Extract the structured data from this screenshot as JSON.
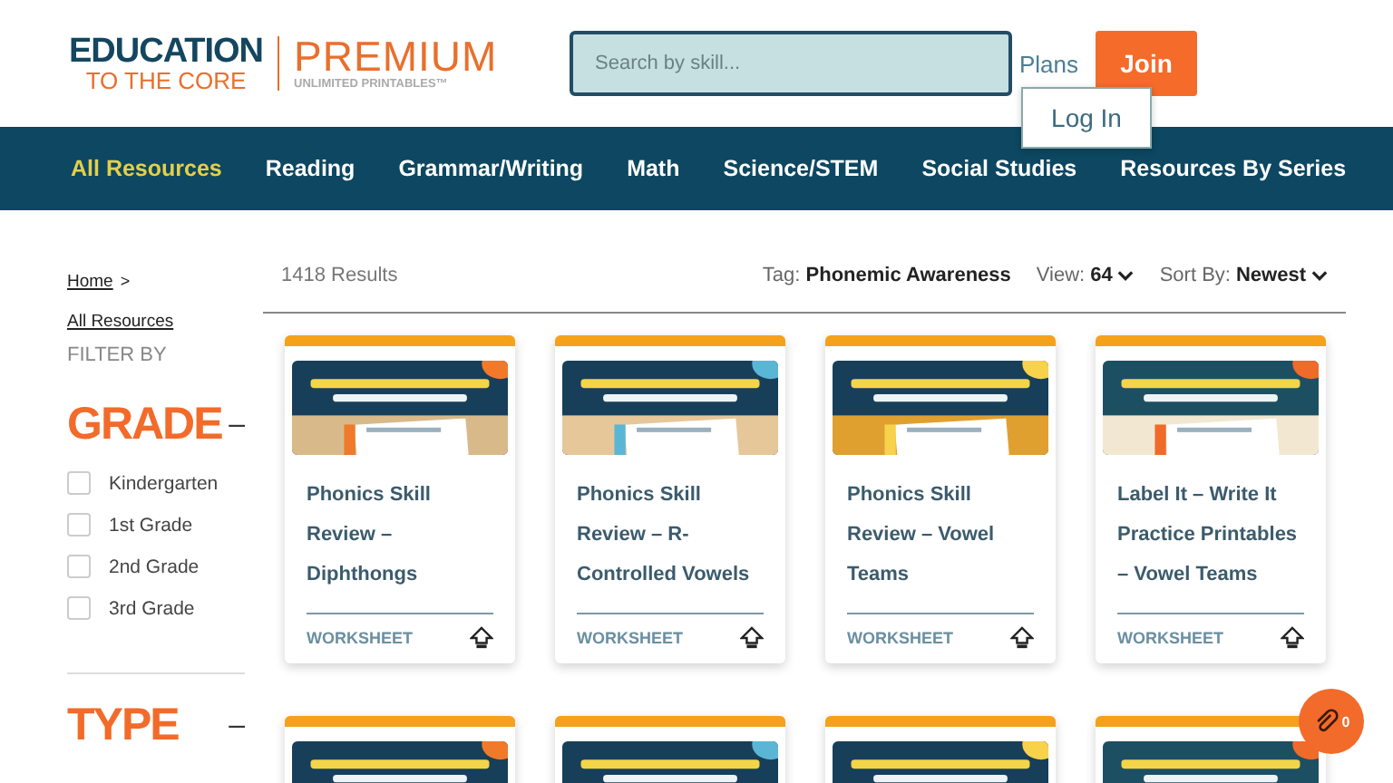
{
  "logo": {
    "line_1": "EDUCATION",
    "line_2": "TO THE CORE",
    "premium": "PREMIUM",
    "tagline": "UNLIMITED PRINTABLES™"
  },
  "search": {
    "placeholder": "Search by skill..."
  },
  "plans": "Plans",
  "join": "Join",
  "login": "Log In",
  "nav": [
    {
      "label": "All Resources",
      "selected": true
    },
    {
      "label": "Reading",
      "selected": false
    },
    {
      "label": "Grammar/Writing",
      "selected": false
    },
    {
      "label": "Math",
      "selected": false
    },
    {
      "label": "Science/STEM",
      "selected": false
    },
    {
      "label": "Social Studies",
      "selected": false
    },
    {
      "label": "Resources By Series",
      "selected": false
    }
  ],
  "breadcrumb": [
    "Home",
    "All Resources"
  ],
  "breadcrumb_separator": ">",
  "filter_by": "FILTER BY",
  "filters": [
    {
      "title": "GRADE",
      "toggle": "–",
      "options": [
        {
          "label": "Kindergarten",
          "checked": false
        },
        {
          "label": "1st Grade",
          "checked": false
        },
        {
          "label": "2nd Grade",
          "checked": false
        },
        {
          "label": "3rd Grade",
          "checked": false
        }
      ]
    },
    {
      "title": "TYPE",
      "toggle": "–"
    }
  ],
  "results": "1418 Results",
  "tag": {
    "label": "Tag:",
    "value": "Phonemic Awareness"
  },
  "view": {
    "label": "View:",
    "value": "64"
  },
  "sort": {
    "label": "Sort By:",
    "value": "Newest"
  },
  "cards": [
    {
      "kind": "product",
      "title": "Phonics Skill Review – Diphthongs",
      "type": "WORKSHEET"
    },
    {
      "kind": "product",
      "title": "Phonics Skill Review – R-Controlled Vowels",
      "type": "WORKSHEET"
    },
    {
      "kind": "product",
      "title": "Phonics Skill Review – Vowel Teams",
      "type": "WORKSHEET"
    },
    {
      "kind": "product",
      "title": "Label It – Write It Practice Printables – Vowel Teams",
      "type": "WORKSHEET"
    },
    {
      "kind": "picture"
    },
    {
      "kind": "picture"
    },
    {
      "kind": "picture"
    },
    {
      "kind": "picture"
    }
  ],
  "clip_badge": "0"
}
